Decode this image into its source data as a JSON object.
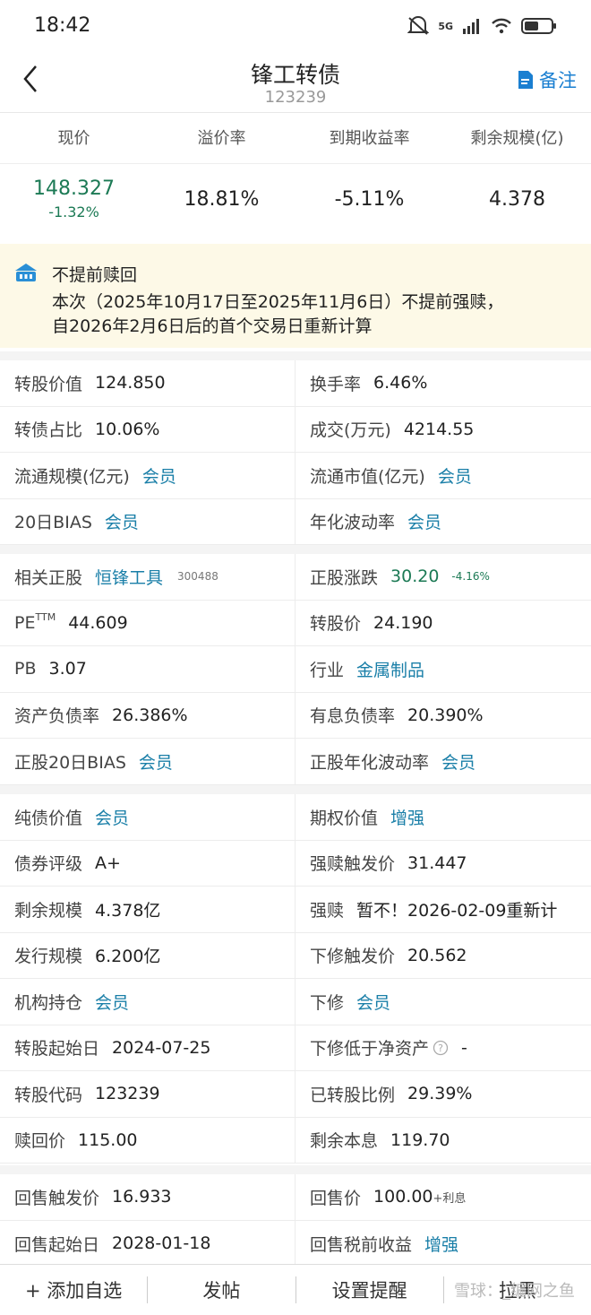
{
  "status": {
    "time": "18:42",
    "network": "5G"
  },
  "header": {
    "title": "锋工转债",
    "code": "123239",
    "note_label": "备注"
  },
  "quote": {
    "headers": [
      "现价",
      "溢价率",
      "到期收益率",
      "剩余规模(亿)"
    ],
    "price": "148.327",
    "change": "-1.32%",
    "premium": "18.81%",
    "ytm": "-5.11%",
    "remaining": "4.378"
  },
  "notice": {
    "title": "不提前赎回",
    "line1": "本次（2025年10月17日至2025年11月6日）不提前强赎，",
    "line2": "自2026年2月6日后的首个交易日重新计算"
  },
  "section1": [
    {
      "l_label": "转股价值",
      "l_val": "124.850",
      "r_label": "换手率",
      "r_val": "6.46%"
    },
    {
      "l_label": "转债占比",
      "l_val": "10.06%",
      "r_label": "成交(万元)",
      "r_val": "4214.55"
    },
    {
      "l_label": "流通规模(亿元)",
      "l_val": "会员",
      "r_label": "流通市值(亿元)",
      "r_val": "会员"
    },
    {
      "l_label": "20日BIAS",
      "l_val": "会员",
      "r_label": "年化波动率",
      "r_val": "会员"
    }
  ],
  "section2": {
    "stock_label": "相关正股",
    "stock_name": "恒锋工具",
    "stock_code": "300488",
    "change_label": "正股涨跌",
    "stock_price": "30.20",
    "stock_change": "-4.16%",
    "pe_label": "PE",
    "pe_sup": "TTM",
    "pe_val": "44.609",
    "conv_price_label": "转股价",
    "conv_price": "24.190",
    "pb_label": "PB",
    "pb_val": "3.07",
    "industry_label": "行业",
    "industry": "金属制品",
    "debt_label": "资产负债率",
    "debt_val": "26.386%",
    "idebt_label": "有息负债率",
    "idebt_val": "20.390%",
    "bias_label": "正股20日BIAS",
    "bias_val": "会员",
    "vol_label": "正股年化波动率",
    "vol_val": "会员"
  },
  "section3": [
    {
      "l_label": "纯债价值",
      "l_val": "会员",
      "l_blue": true,
      "r_label": "期权价值",
      "r_val": "增强",
      "r_blue": true
    },
    {
      "l_label": "债券评级",
      "l_val": "A+",
      "r_label": "强赎触发价",
      "r_val": "31.447"
    },
    {
      "l_label": "剩余规模",
      "l_val": "4.378亿",
      "r_label": "强赎",
      "r_val": "暂不！2026-02-09重新计"
    },
    {
      "l_label": "发行规模",
      "l_val": "6.200亿",
      "r_label": "下修触发价",
      "r_val": "20.562"
    },
    {
      "l_label": "机构持仓",
      "l_val": "会员",
      "l_blue": true,
      "r_label": "下修",
      "r_val": "会员",
      "r_blue": true
    },
    {
      "l_label": "转股起始日",
      "l_val": "2024-07-25",
      "r_label": "下修低于净资产",
      "r_val": "-",
      "r_help": true
    },
    {
      "l_label": "转股代码",
      "l_val": "123239",
      "r_label": "已转股比例",
      "r_val": "29.39%"
    },
    {
      "l_label": "赎回价",
      "l_val": "115.00",
      "r_label": "剩余本息",
      "r_val": "119.70"
    }
  ],
  "section4": {
    "putback_trigger_label": "回售触发价",
    "putback_trigger": "16.933",
    "putback_price_label": "回售价",
    "putback_price": "100.00",
    "putback_price_suffix": "+利息",
    "putback_start_label": "回售起始日",
    "putback_start": "2028-01-18",
    "putback_yield_label": "回售税前收益",
    "putback_yield": "增强"
  },
  "bottom": {
    "add_label": "+ 添加自选",
    "post_label": "发帖",
    "alert_label": "设置提醒",
    "block_label": "拉黑"
  },
  "watermark": "雪球：_编网之鱼"
}
